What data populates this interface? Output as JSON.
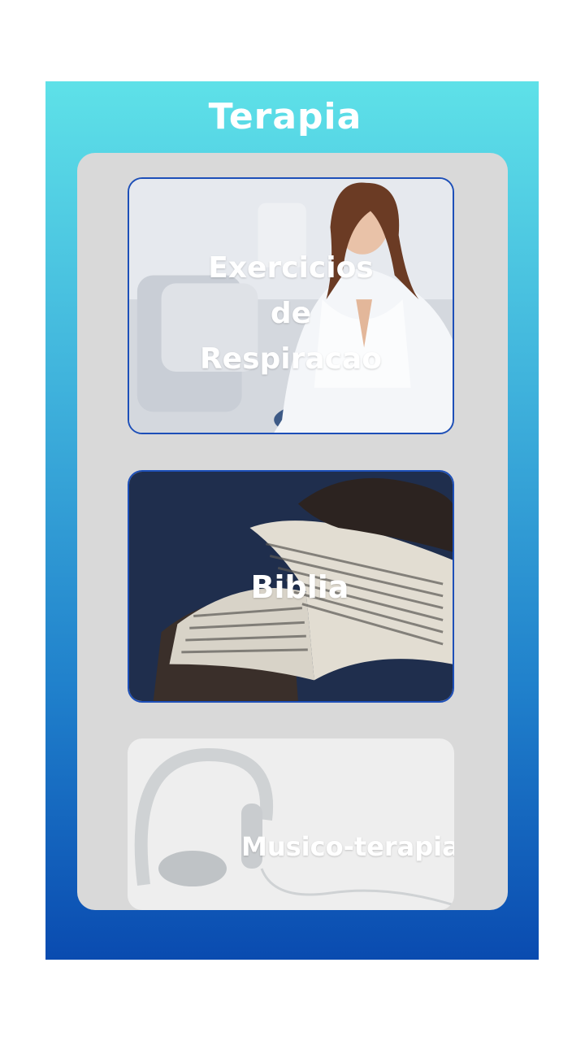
{
  "header": {
    "title": "Terapia"
  },
  "cards": [
    {
      "label_lines": [
        "Exercicios",
        "de",
        "Respiracao"
      ],
      "image_icon": "meditation-photo"
    },
    {
      "label": "Biblia",
      "image_icon": "open-bible-photo"
    },
    {
      "label": "Musico-terapia",
      "image_icon": "headphones-photo"
    }
  ],
  "colors": {
    "gradient_top": "#5ee1e8",
    "gradient_bottom": "#0a4bb0",
    "panel": "#d9d9d9",
    "card_border": "#1d4fb8",
    "text": "#ffffff"
  }
}
